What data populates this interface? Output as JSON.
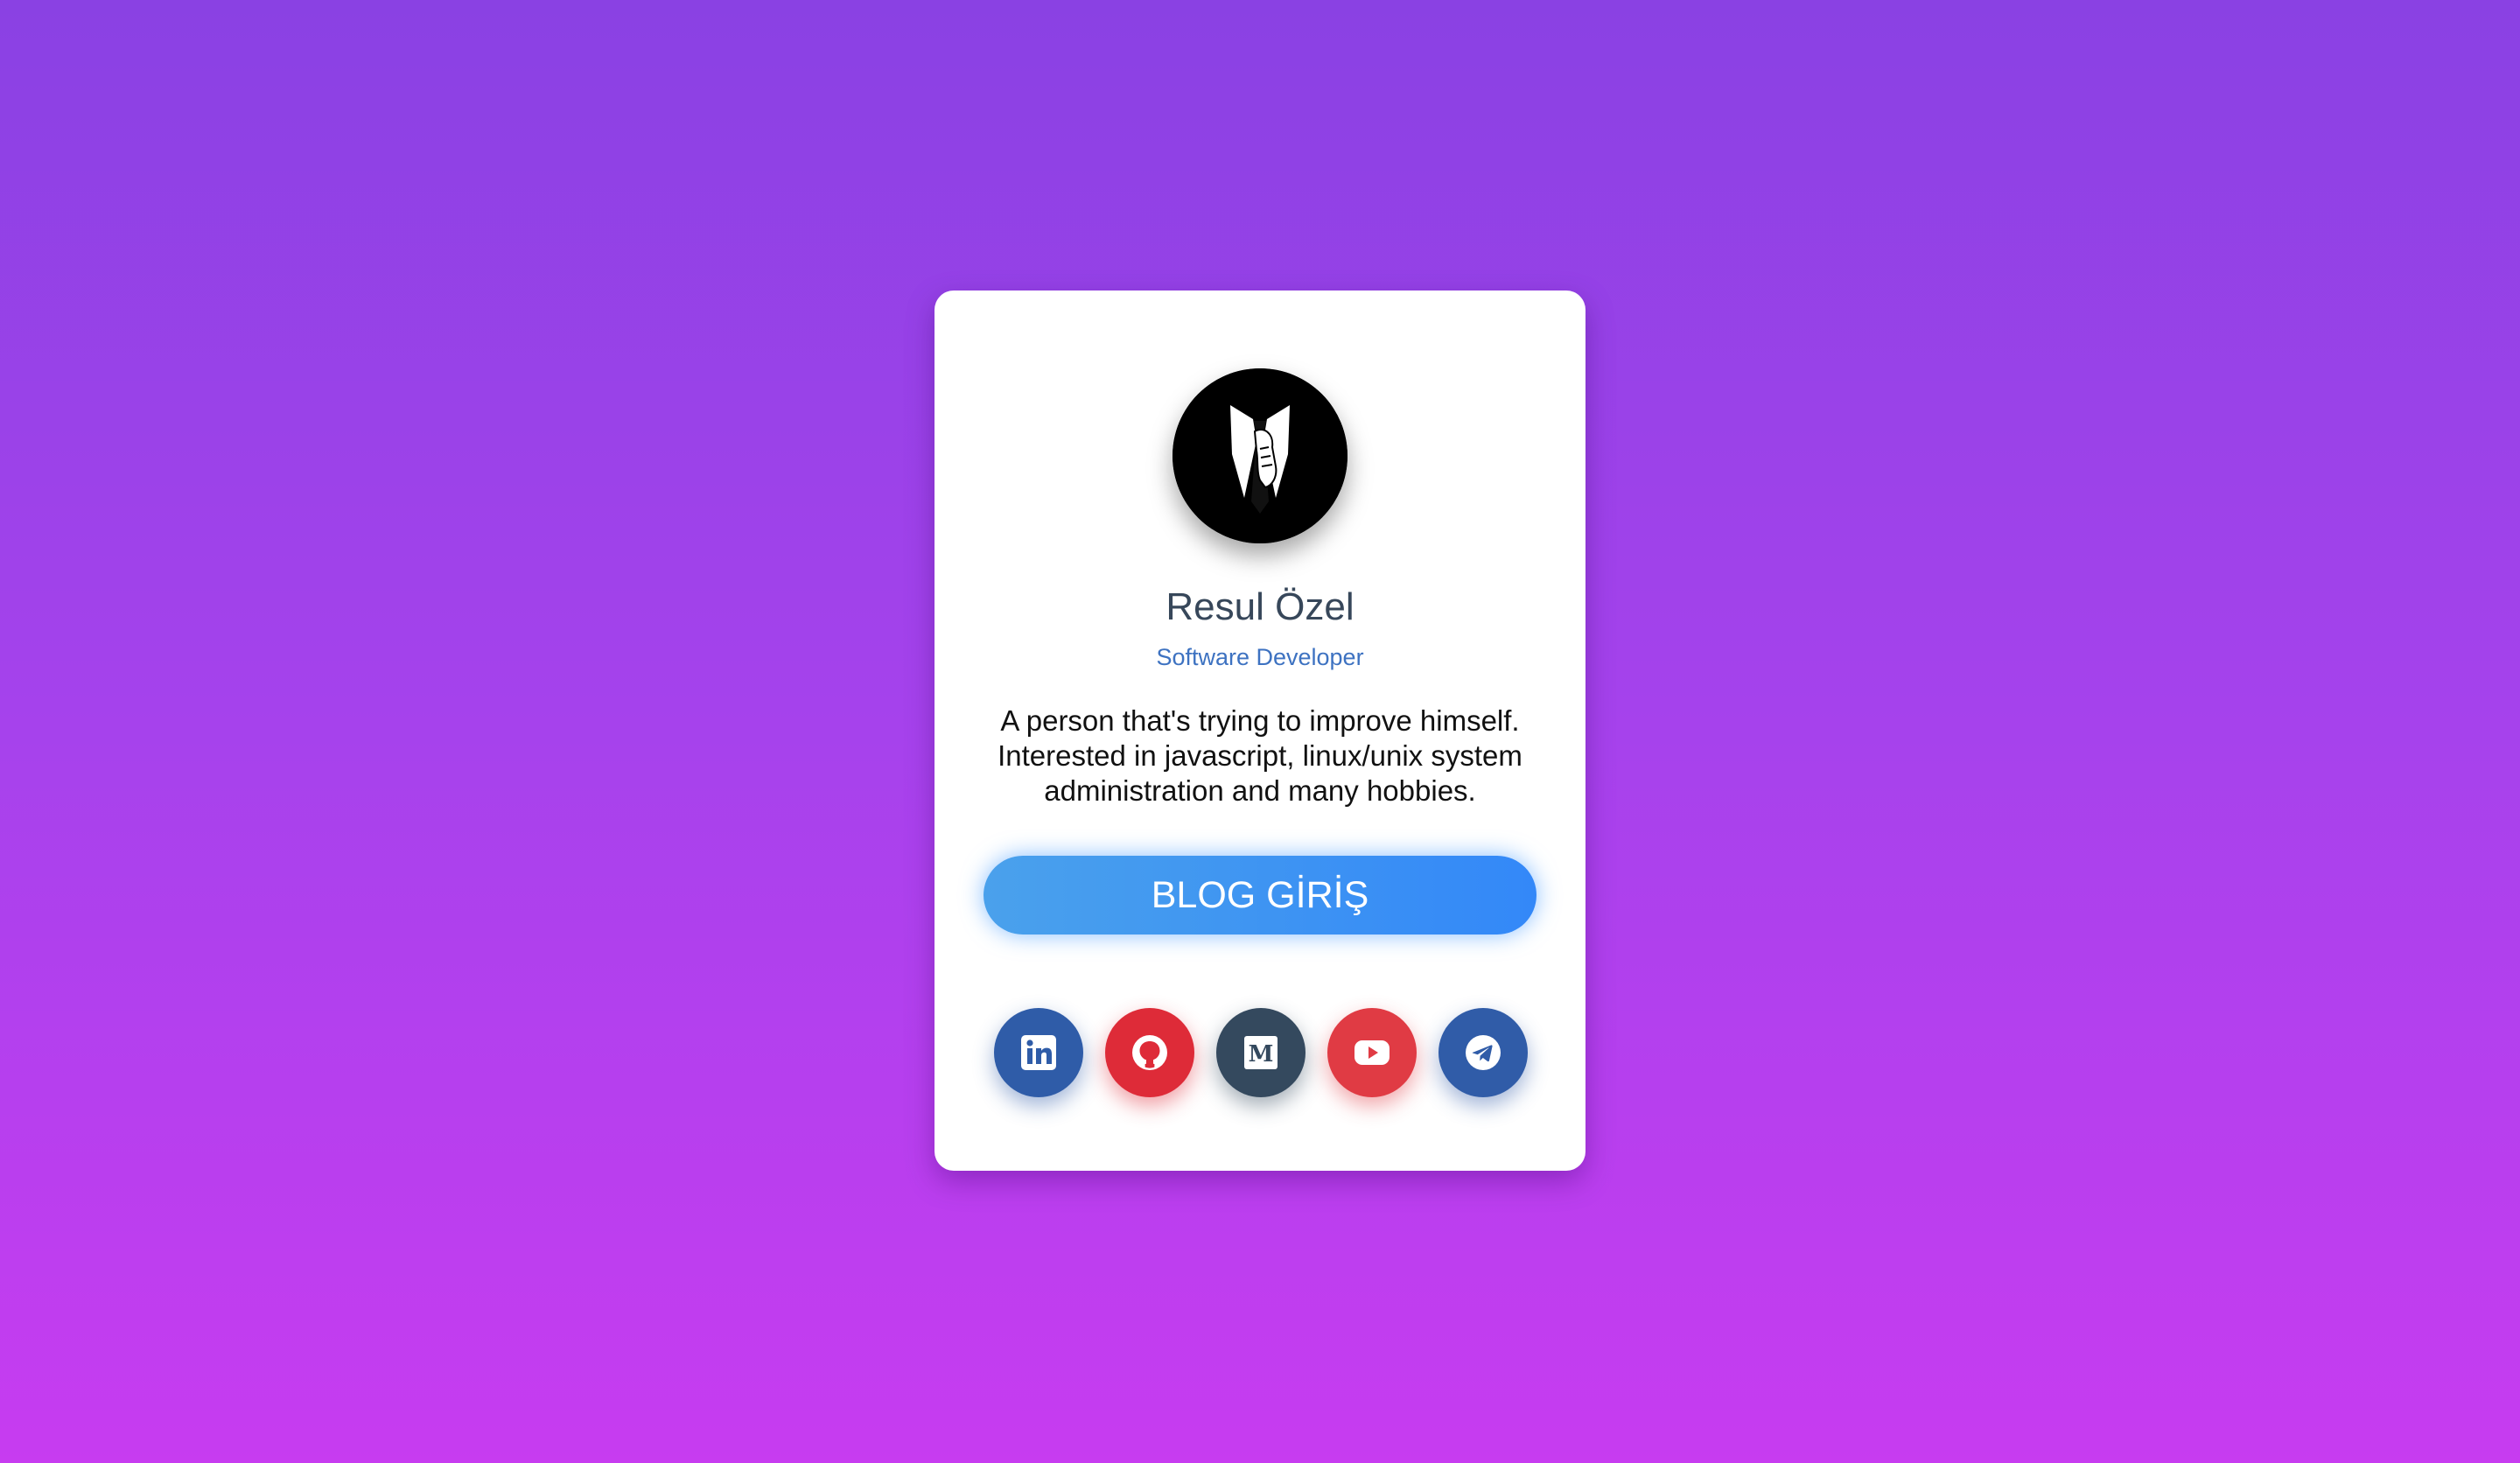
{
  "profile": {
    "name": "Resul Özel",
    "role": "Software Developer",
    "bio": "A person that's trying to improve himself. Interested in javascript, linux/unix system administration and many hobbies."
  },
  "blog_button": {
    "label": "BLOG GİRİŞ"
  },
  "socials": [
    {
      "icon": "linkedin-icon",
      "color": "#2f5ca8"
    },
    {
      "icon": "github-icon",
      "color": "#de2b38"
    },
    {
      "icon": "medium-icon",
      "color": "#34495e"
    },
    {
      "icon": "youtube-icon",
      "color": "#e03b44"
    },
    {
      "icon": "telegram-icon",
      "color": "#305ca8"
    }
  ],
  "colors": {
    "background_top": "#8a41e3",
    "background_bottom": "#c73cf0",
    "name": "#37475a",
    "role": "#3d72c1",
    "button_start": "#4aa1ec",
    "button_end": "#3388f8"
  }
}
